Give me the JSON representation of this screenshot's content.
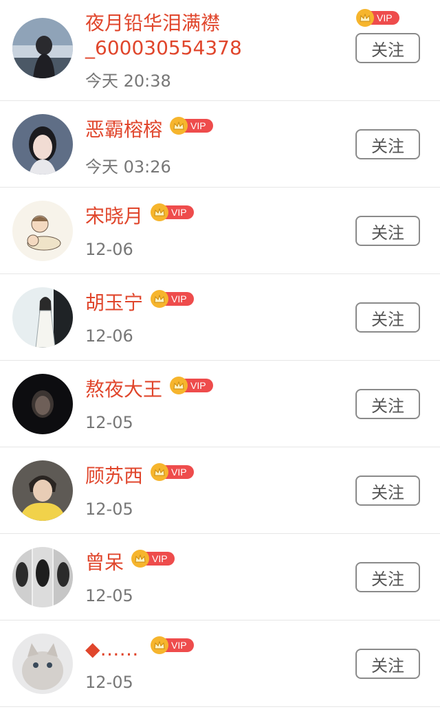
{
  "follow_label": "关注",
  "vip_label": "VIP",
  "users": [
    {
      "name": "夜月铅华泪满襟_600030554378",
      "time": "今天 20:38",
      "avatar_icon": "avatar-seaside-girl"
    },
    {
      "name": "恶霸榕榕",
      "time": "今天 03:26",
      "avatar_icon": "avatar-selfie-girl"
    },
    {
      "name": "宋晓月",
      "time": "12-06",
      "avatar_icon": "avatar-cartoon-boys"
    },
    {
      "name": "胡玉宁",
      "time": "12-06",
      "avatar_icon": "avatar-ink-painting-figure"
    },
    {
      "name": "熬夜大王",
      "time": "12-05",
      "avatar_icon": "avatar-dark-portrait"
    },
    {
      "name": "顾苏西",
      "time": "12-05",
      "avatar_icon": "avatar-yellow-shirt-boy"
    },
    {
      "name": "曾呆",
      "time": "12-05",
      "avatar_icon": "avatar-bw-collage"
    },
    {
      "name": "◆……",
      "time": "12-05",
      "avatar_icon": "avatar-cat"
    }
  ],
  "colors": {
    "name": "#e0462c",
    "vip_pill": "#ee4c4c",
    "crown": "#f6b52d",
    "time": "#777777"
  }
}
